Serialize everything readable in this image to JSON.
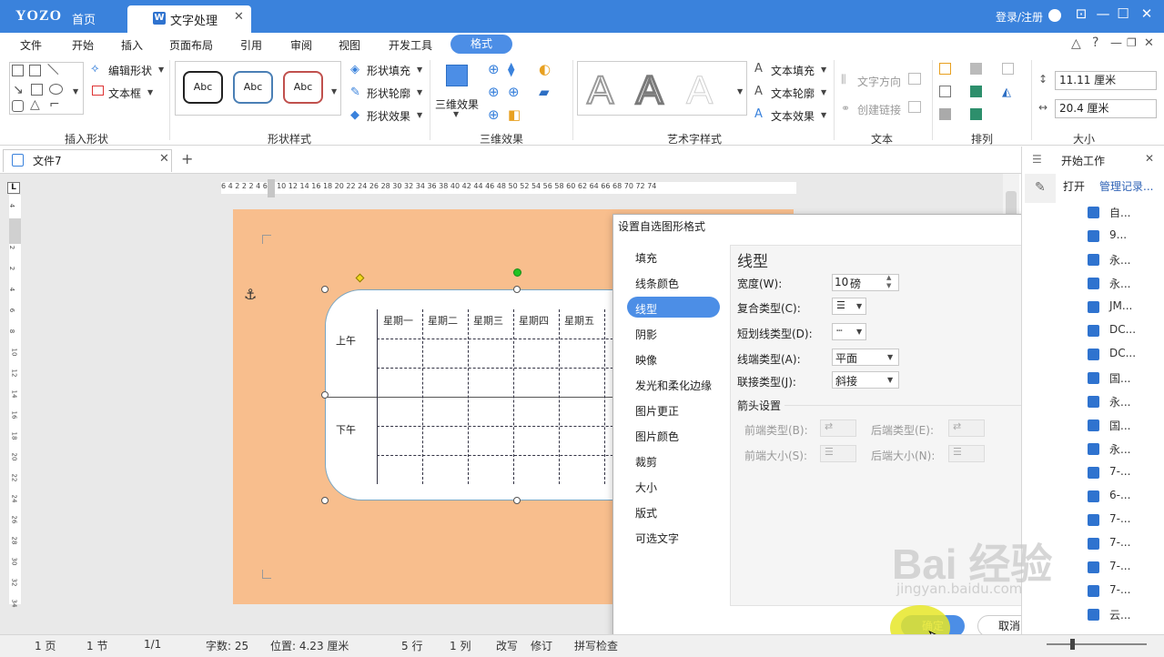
{
  "titlebar": {
    "logo": "YOZO",
    "home": "首页",
    "doc_tab": "文字处理",
    "doc_icon": "W",
    "login": "登录/注册",
    "accent": "#3a82dc"
  },
  "menu": [
    "文件",
    "开始",
    "插入",
    "页面布局",
    "引用",
    "审阅",
    "视图",
    "开发工具",
    "格式"
  ],
  "ribbon": {
    "insert_shape": {
      "edit_shape": "编辑形状",
      "text_box": "文本框",
      "label": "插入形状"
    },
    "shape_style": {
      "abc": [
        "Abc",
        "Abc",
        "Abc"
      ],
      "fill": "形状填充",
      "outline": "形状轮廓",
      "effect": "形状效果",
      "label": "形状样式"
    },
    "three_d": {
      "btn": "三维效果",
      "label": "三维效果"
    },
    "art": {
      "glyphs": [
        "A",
        "A",
        "A"
      ],
      "fill": "文本填充",
      "outline": "文本轮廓",
      "effect": "文本效果",
      "label": "艺术字样式"
    },
    "text": {
      "direction": "文字方向",
      "link": "创建链接",
      "label": "文本"
    },
    "arrange": {
      "label": "排列"
    },
    "size": {
      "height": "11.11 厘米",
      "width": "20.4 厘米",
      "label": "大小"
    }
  },
  "file_tab": "文件7",
  "ruler_h": "6 4 2 2 2 4 6 8 10 12 14 16 18 20 22 24 26 28 30 32 34 36 38 40 42 44 46 48 50 52 54 56 58 60 62 64 66 68 70 72 74",
  "ruler_v": [
    "4",
    "2",
    "2",
    "2",
    "4",
    "6",
    "8",
    "10",
    "12",
    "14",
    "16",
    "18",
    "20",
    "22",
    "24",
    "26",
    "28",
    "30",
    "32",
    "34"
  ],
  "table": {
    "days": [
      "星期一",
      "星期二",
      "星期三",
      "星期四",
      "星期五"
    ],
    "am": "上午",
    "pm": "下午"
  },
  "dialog": {
    "title": "设置自选图形格式",
    "nav": [
      "填充",
      "线条颜色",
      "线型",
      "阴影",
      "映像",
      "发光和柔化边缘",
      "图片更正",
      "图片颜色",
      "裁剪",
      "大小",
      "版式",
      "可选文字"
    ],
    "active_nav": "线型",
    "section": "线型",
    "width_label": "宽度(W):",
    "width_value": "10",
    "width_unit": "磅",
    "compound_label": "复合类型(C):",
    "dash_label": "短划线类型(D):",
    "cap_label": "线端类型(A):",
    "cap_value": "平面",
    "join_label": "联接类型(J):",
    "join_value": "斜接",
    "arrow_section": "箭头设置",
    "begin_type": "前端类型(B):",
    "end_type": "后端类型(E):",
    "begin_size": "前端大小(S):",
    "end_size": "后端大小(N):",
    "ok": "确定",
    "cancel": "取消"
  },
  "right_panel": {
    "title": "开始工作",
    "open": "打开",
    "manage": "管理记录...",
    "files": [
      "自...",
      "9...",
      "永...",
      "永...",
      "JM...",
      "DC...",
      "DC...",
      "国...",
      "永...",
      "国...",
      "永...",
      "7-...",
      "6-...",
      "7-...",
      "7-...",
      "7-...",
      "7-...",
      "云..."
    ]
  },
  "status": {
    "page": "1 页",
    "section": "1 节",
    "pages": "1/1",
    "words": "字数: 25",
    "position": "位置: 4.23 厘米",
    "row": "5 行",
    "col": "1 列",
    "overwrite": "改写",
    "revise": "修订",
    "spell": "拼写检查"
  },
  "watermark": {
    "main": "Bai 经验",
    "url": "jingyan.baidu.com"
  }
}
